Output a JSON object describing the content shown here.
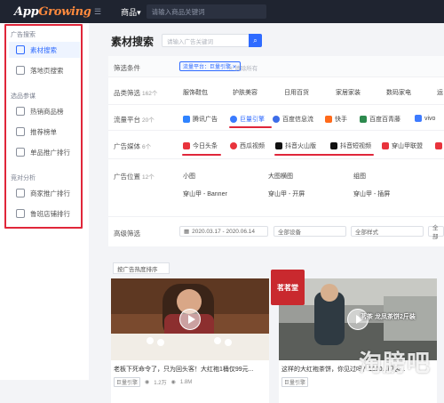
{
  "app": {
    "logo_a": "App",
    "logo_b": "Growing",
    "menu_icon": "menu-icon"
  },
  "topbar": {
    "product_label": "商品▾",
    "search_placeholder": "请输入商品关键词"
  },
  "sidebar": {
    "sections": [
      {
        "title": "广告搜索",
        "items": [
          {
            "label": "素材搜索",
            "icon": "grid-icon",
            "active": true
          },
          {
            "label": "落地页搜索",
            "icon": "page-icon",
            "active": false
          }
        ]
      },
      {
        "title": "选品参谋",
        "items": [
          {
            "label": "热销商品榜",
            "icon": "fire-icon",
            "active": false
          },
          {
            "label": "推荐榜单",
            "icon": "recommend-icon",
            "active": false
          },
          {
            "label": "单品推广排行",
            "icon": "rank-icon",
            "active": false
          }
        ]
      },
      {
        "title": "竞对分析",
        "items": [
          {
            "label": "商家推广排行",
            "icon": "merchant-icon",
            "active": false
          },
          {
            "label": "鲁班店铺排行",
            "icon": "shop-icon",
            "active": false
          }
        ]
      }
    ]
  },
  "main": {
    "title": "素材搜索",
    "search_placeholder": "请输入广告关键词",
    "filters": {
      "conditions": {
        "label": "筛选条件",
        "tag": "流量平台：巨量引擎 ✕",
        "clear": "✕ 清除所有"
      },
      "category": {
        "label": "品类筛选",
        "count": "162个",
        "options": [
          "服饰鞋包",
          "护肤美容",
          "日用百货",
          "家居家装",
          "数码家电",
          "运"
        ]
      },
      "platform": {
        "label": "流量平台",
        "count": "20个",
        "options": [
          "腾讯广告",
          "巨量引擎",
          "百度信息流",
          "快手",
          "百度百青藤",
          "vivo"
        ]
      },
      "media": {
        "label": "广告媒体",
        "count": "6个",
        "options": [
          "今日头条",
          "西瓜视频",
          "抖音火山版",
          "抖音短视频",
          "穿山甲联盟",
          "抖"
        ]
      },
      "position": {
        "label": "广告位置",
        "count": "12个",
        "options": [
          "小图",
          "大图横图",
          "组图",
          "穿山甲 - Banner",
          "穿山甲 - 开屏",
          "穿山甲 - 插屏"
        ]
      },
      "advanced": {
        "label": "高级筛选",
        "date_range": "2020.03.17 - 2020.06.14",
        "sel1": "全部设备",
        "sel2": "全部样式",
        "sel3": "全部"
      }
    },
    "sort": "按广告热度排序",
    "cards": [
      {
        "title": "老板下死命令了，只为回头客！大红袍1桶仅99元...",
        "tag": "巨量引擎",
        "stat1": "1.2万",
        "stat2": "1.8M"
      },
      {
        "title": "这样的大红袍茶饼，你见过吗？1000...门店...",
        "tag": "巨量引擎",
        "stat1": "",
        "stat2": ""
      }
    ],
    "card2_overlay": "茗茶 龙凤茶饼2斤装",
    "card2_badge": "茗茗堂"
  },
  "watermark": "淘膀吧",
  "colors": {
    "accent": "#2f6bff",
    "highlight": "#e0263a",
    "topbar": "#1f2430"
  }
}
